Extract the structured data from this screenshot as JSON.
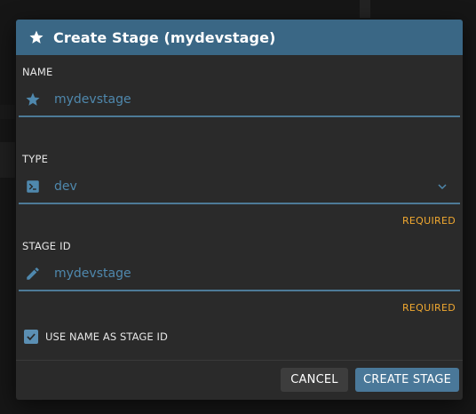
{
  "dialog": {
    "title": "Create Stage (mydevstage)",
    "header_icon": "star-icon"
  },
  "fields": {
    "name": {
      "label": "NAME",
      "value": "mydevstage",
      "icon": "star-icon"
    },
    "type": {
      "label": "TYPE",
      "value": "dev",
      "icon": "terminal-icon",
      "required_text": "REQUIRED"
    },
    "stage_id": {
      "label": "STAGE ID",
      "placeholder": "mydevstage",
      "icon": "pencil-icon",
      "required_text": "REQUIRED"
    }
  },
  "checkbox": {
    "label": "USE NAME AS STAGE ID",
    "checked": true
  },
  "buttons": {
    "cancel": "CANCEL",
    "create": "CREATE STAGE"
  },
  "colors": {
    "header": "#3a6785",
    "accent": "#4f88ad",
    "required": "#f0a830",
    "primary_button": "#4a7899"
  }
}
